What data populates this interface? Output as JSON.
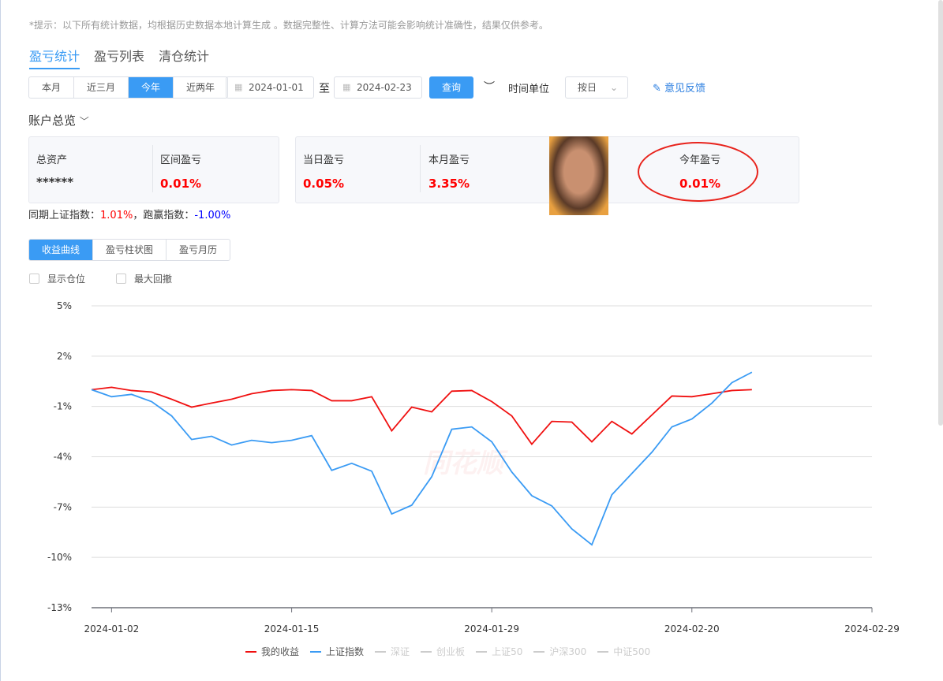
{
  "tip": "*提示：以下所有统计数据，均根据历史数据本地计算生成 。数据完整性、计算方法可能会影响统计准确性，结果仅供参考。",
  "tabs": [
    "盈亏统计",
    "盈亏列表",
    "清仓统计"
  ],
  "range_buttons": [
    "本月",
    "近三月",
    "今年",
    "近两年"
  ],
  "start_date": "2024-01-01",
  "to": "至",
  "end_date": "2024-02-23",
  "query": "查询",
  "time_unit_label": "时间单位",
  "time_unit_value": "按日",
  "feedback": "意见反馈",
  "overview_title": "账户总览",
  "card1": [
    {
      "label": "总资产",
      "value": "******"
    },
    {
      "label": "区间盈亏",
      "value": "0.01%"
    }
  ],
  "card2": [
    {
      "label": "当日盈亏",
      "value": "0.05%"
    },
    {
      "label": "本月盈亏",
      "value": "3.35%"
    },
    {
      "label": "今年盈亏",
      "value": "0.01%"
    }
  ],
  "compare": {
    "sh_label": "同期上证指数：",
    "sh_value": "1.01%",
    "sep": "，",
    "beat_label": "跑赢指数：",
    "beat_value": "-1.00%"
  },
  "chart_tabs": [
    "收益曲线",
    "盈亏柱状图",
    "盈亏月历"
  ],
  "checkboxes": [
    "显示仓位",
    "最大回撤"
  ],
  "watermark": "同花顺",
  "chart_data": {
    "type": "line",
    "ylim": [
      -13,
      5
    ],
    "yticks": [
      "5%",
      "2%",
      "-1%",
      "-4%",
      "-7%",
      "-10%",
      "-13%"
    ],
    "ytick_values": [
      5,
      2,
      -1,
      -4,
      -7,
      -10,
      -13
    ],
    "x_slots": 40,
    "xticks": [
      {
        "index": 1,
        "label": "2024-01-02"
      },
      {
        "index": 10,
        "label": "2024-01-15"
      },
      {
        "index": 20,
        "label": "2024-01-29"
      },
      {
        "index": 30,
        "label": "2024-02-20"
      },
      {
        "index": 39,
        "label": "2024-02-29"
      }
    ],
    "series": [
      {
        "name": "我的收益",
        "color": "#f01010",
        "values": [
          0,
          0.14,
          -0.05,
          -0.14,
          -0.57,
          -1.04,
          -0.8,
          -0.57,
          -0.24,
          -0.05,
          0,
          -0.05,
          -0.66,
          -0.66,
          -0.42,
          -2.45,
          -1.04,
          -1.32,
          -0.09,
          -0.05,
          -0.71,
          -1.56,
          -3.25,
          -1.89,
          -1.93,
          -3.11,
          -1.89,
          -2.64,
          -1.51,
          -0.38,
          -0.42,
          -0.24,
          -0.05,
          0
        ]
      },
      {
        "name": "上证指数",
        "color": "#3a9bf4",
        "values": [
          0,
          -0.42,
          -0.28,
          -0.71,
          -1.56,
          -2.97,
          -2.78,
          -3.3,
          -3.02,
          -3.16,
          -3.02,
          -2.74,
          -4.81,
          -4.39,
          -4.86,
          -7.41,
          -6.89,
          -5.19,
          -2.36,
          -2.22,
          -3.11,
          -4.91,
          -6.32,
          -6.93,
          -8.3,
          -9.25,
          -6.27,
          -5,
          -3.73,
          -2.22,
          -1.75,
          -0.8,
          0.42,
          1.04
        ]
      }
    ],
    "legend": [
      {
        "name": "我的收益",
        "color": "#f01010"
      },
      {
        "name": "上证指数",
        "color": "#3a9bf4"
      },
      {
        "name": "深证",
        "color": "#ccc"
      },
      {
        "name": "创业板",
        "color": "#ccc"
      },
      {
        "name": "上证50",
        "color": "#ccc"
      },
      {
        "name": "沪深300",
        "color": "#ccc"
      },
      {
        "name": "中证500",
        "color": "#ccc"
      }
    ]
  }
}
